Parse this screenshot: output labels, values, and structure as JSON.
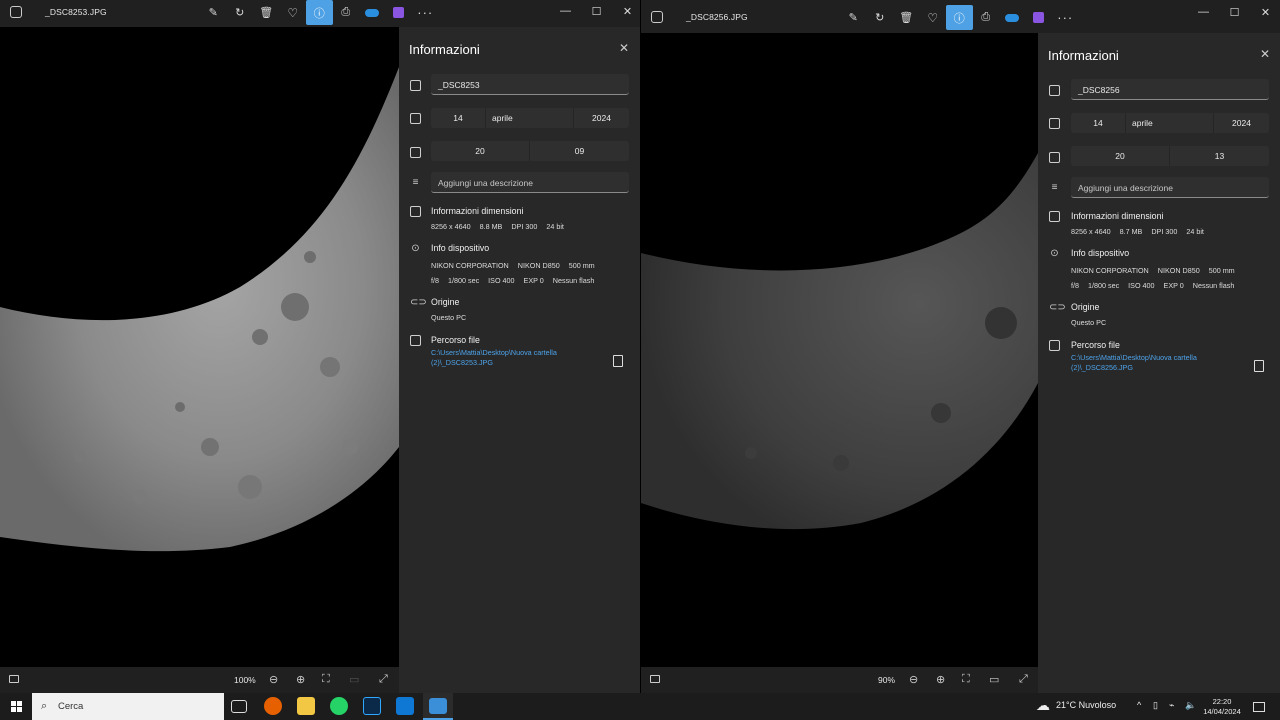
{
  "left_window": {
    "title": "_DSC8253.JPG",
    "zoom": "100%",
    "panel": {
      "heading": "Informazioni",
      "file_name": "_DSC8253",
      "date": {
        "day": "14",
        "month": "aprile",
        "year": "2024"
      },
      "time": {
        "hour": "20",
        "minute": "09"
      },
      "description_placeholder": "Aggiungi una descrizione",
      "dimensions_title": "Informazioni dimensioni",
      "dimensions": [
        "8256 x 4640",
        "8.8 MB",
        "DPI 300",
        "24 bit"
      ],
      "device_title": "Info dispositivo",
      "device_line1": [
        "NIKON CORPORATION",
        "NIKON D850",
        "500 mm"
      ],
      "device_line2": [
        "f/8",
        "1/800 sec",
        "ISO 400",
        "EXP 0",
        "Nessun flash"
      ],
      "origin_title": "Origine",
      "origin_value": "Questo PC",
      "path_title": "Percorso file",
      "path_value": "C:\\Users\\Mattia\\Desktop\\Nuova cartella (2)\\_DSC8253.JPG"
    }
  },
  "right_window": {
    "title": "_DSC8256.JPG",
    "zoom": "90%",
    "panel": {
      "heading": "Informazioni",
      "file_name": "_DSC8256",
      "date": {
        "day": "14",
        "month": "aprile",
        "year": "2024"
      },
      "time": {
        "hour": "20",
        "minute": "13"
      },
      "description_placeholder": "Aggiungi una descrizione",
      "dimensions_title": "Informazioni dimensioni",
      "dimensions": [
        "8256 x 4640",
        "8.7 MB",
        "DPI 300",
        "24 bit"
      ],
      "device_title": "Info dispositivo",
      "device_line1": [
        "NIKON CORPORATION",
        "NIKON D850",
        "500 mm"
      ],
      "device_line2": [
        "f/8",
        "1/800 sec",
        "ISO 400",
        "EXP 0",
        "Nessun flash"
      ],
      "origin_title": "Origine",
      "origin_value": "Questo PC",
      "path_title": "Percorso file",
      "path_value": "C:\\Users\\Mattia\\Desktop\\Nuova cartella (2)\\_DSC8256.JPG"
    }
  },
  "taskbar": {
    "search_placeholder": "Cerca",
    "weather": "21°C  Nuvoloso",
    "time": "22:20",
    "date": "14/04/2024"
  },
  "colors": {
    "accent": "#4ea1e4",
    "link": "#4da3ea",
    "panel_bg": "#282828",
    "window_bg": "#202020"
  }
}
